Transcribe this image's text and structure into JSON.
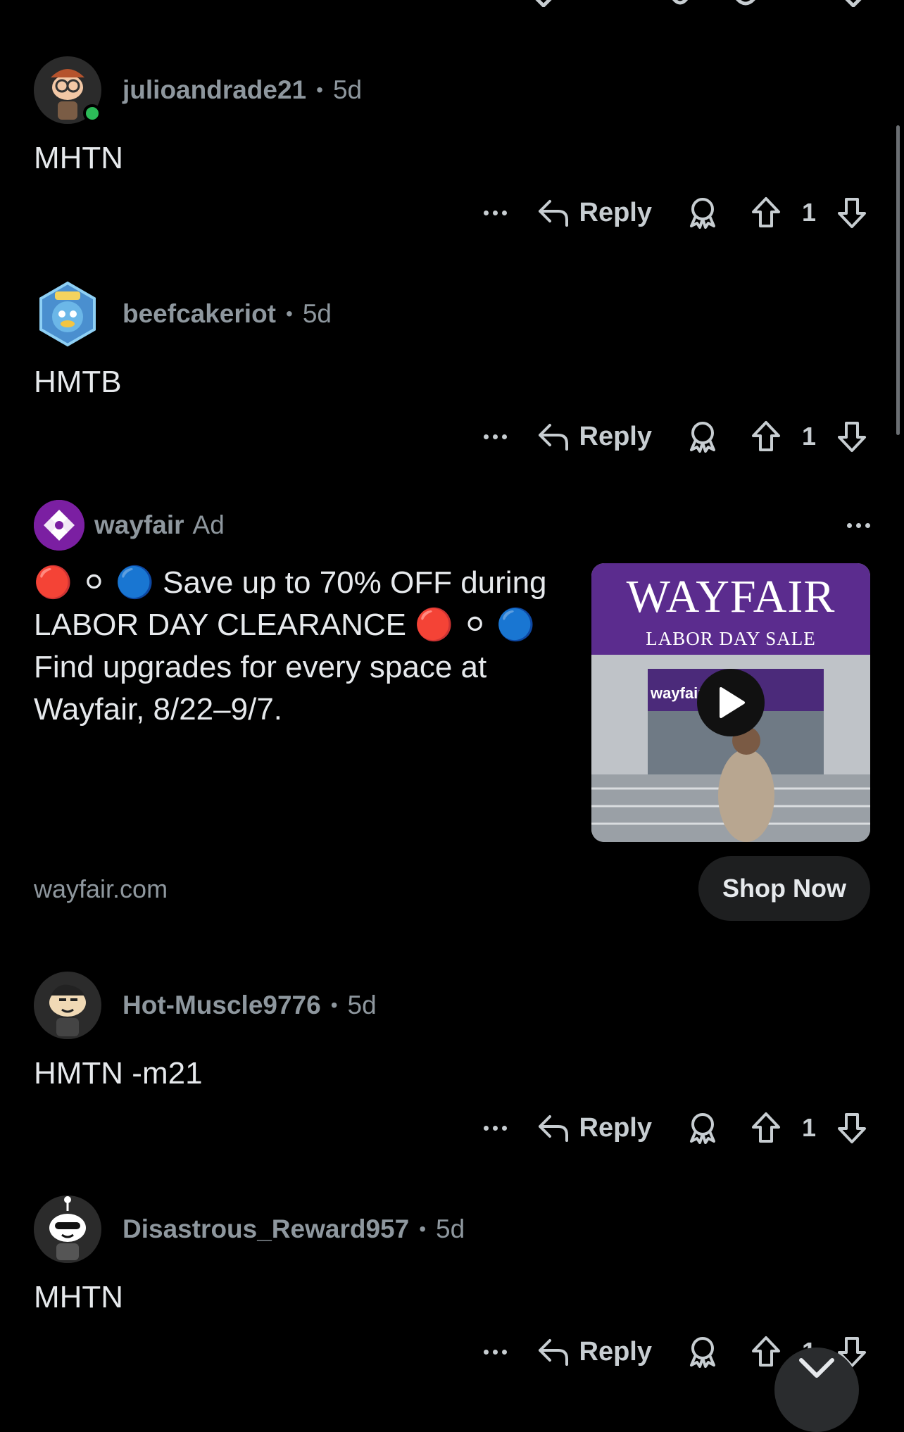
{
  "comments": [
    {
      "username": "julioandrade21",
      "age": "5d",
      "body": "MHTN",
      "reply_label": "Reply",
      "vote_count": "1",
      "online": true
    },
    {
      "username": "beefcakeriot",
      "age": "5d",
      "body": "HMTB",
      "reply_label": "Reply",
      "vote_count": "1"
    },
    {
      "username": "Hot-Muscle9776",
      "age": "5d",
      "body": "HMTN -m21",
      "reply_label": "Reply",
      "vote_count": "1"
    },
    {
      "username": "Disastrous_Reward957",
      "age": "5d",
      "body": "MHTN",
      "reply_label": "Reply",
      "vote_count": "1"
    }
  ],
  "separator": "•",
  "ad": {
    "advertiser": "wayfair",
    "tag": "Ad",
    "text": "🔴 ⚪ 🔵 Save up to 70% OFF during LABOR DAY CLEARANCE 🔴 ⚪ 🔵 Find upgrades for every space at Wayfair, 8/22–9/7.",
    "thumbnail_title": "WAYFAIR",
    "thumbnail_subtitle": "LABOR DAY SALE",
    "thumbnail_sign": "wayfair",
    "domain": "wayfair.com",
    "cta_label": "Shop Now"
  },
  "icons": {
    "more": "more-horizontal-icon",
    "reply": "reply-arrow-icon",
    "award": "award-icon",
    "upvote": "upvote-arrow-icon",
    "downvote": "downvote-arrow-icon",
    "play": "play-icon",
    "jump": "chevron-down-icon"
  },
  "colors": {
    "background": "#000000",
    "text": "#e6e9ec",
    "muted": "#8e979e",
    "wayfair_purple": "#7b1fa2",
    "online": "#2cbb58"
  }
}
